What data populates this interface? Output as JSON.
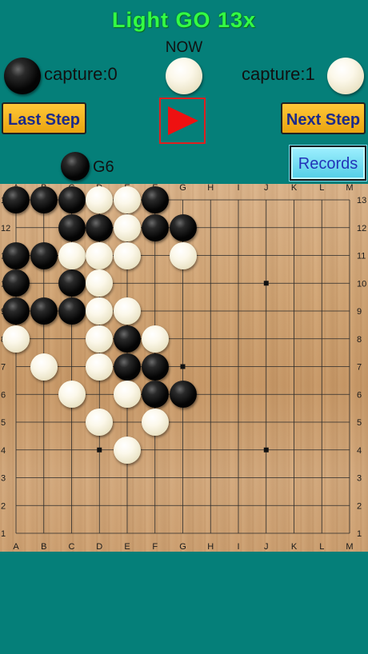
{
  "title": "Light GO 13x",
  "now_label": "NOW",
  "black_capture": "capture:0",
  "white_capture": "capture:1",
  "now_stone_color": "white",
  "buttons": {
    "last_step": "Last Step",
    "next_step": "Next Step",
    "play": "play",
    "records": "Records"
  },
  "last_move": {
    "color": "black",
    "label": "G6"
  },
  "board": {
    "size": 13,
    "columns": [
      "A",
      "B",
      "C",
      "D",
      "E",
      "F",
      "G",
      "H",
      "I",
      "J",
      "K",
      "L",
      "M"
    ],
    "rows": [
      "13",
      "12",
      "11",
      "10",
      "9",
      "8",
      "7",
      "6",
      "5",
      "4",
      "3",
      "2",
      "1"
    ],
    "star_points": [
      "D4",
      "J4",
      "G7",
      "D10",
      "J10"
    ],
    "stones": {
      "black": [
        "A13",
        "B13",
        "C13",
        "F13",
        "C12",
        "D12",
        "F12",
        "G12",
        "A11",
        "B11",
        "A10",
        "C10",
        "A9",
        "B9",
        "C9",
        "E8",
        "E7",
        "F7",
        "F6",
        "G6"
      ],
      "white": [
        "D13",
        "E13",
        "E12",
        "C11",
        "D11",
        "E11",
        "G11",
        "D10",
        "D9",
        "E9",
        "A8",
        "D8",
        "F8",
        "B7",
        "D7",
        "C6",
        "E6",
        "D5",
        "F5",
        "E4"
      ]
    }
  },
  "colors": {
    "background": "#057f79",
    "title": "#33ff44",
    "button": "#f4b42a",
    "button_text": "#1d2b8a",
    "records": "#6fdcf0",
    "play": "#ee1111"
  }
}
